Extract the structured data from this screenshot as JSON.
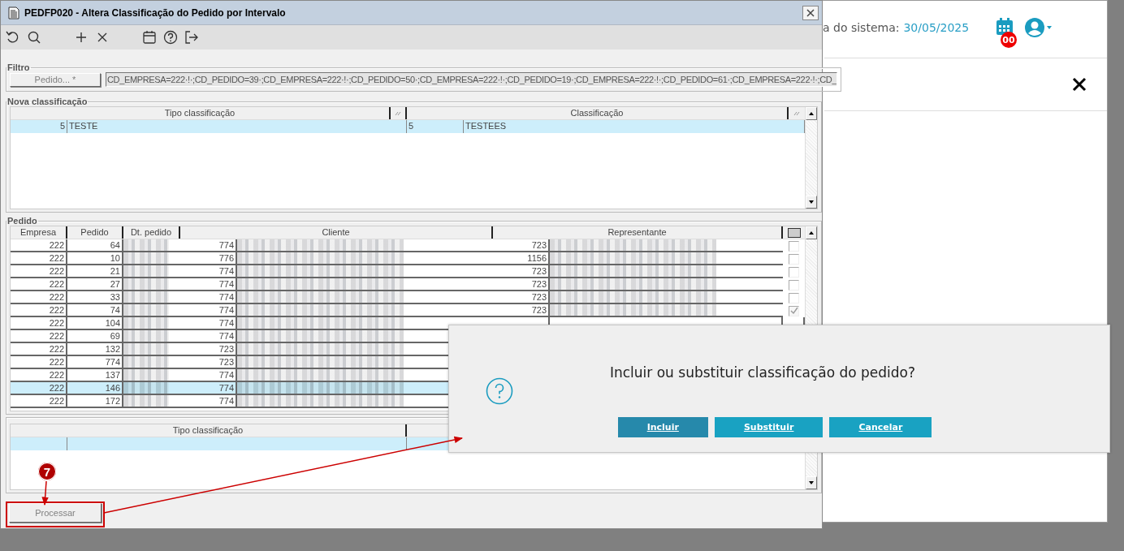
{
  "window": {
    "title": "PEDFP020 - Altera Classificação do Pedido por Intervalo"
  },
  "filter": {
    "legend": "Filtro",
    "button": {
      "label": "Pedido... *",
      "disabled": true
    },
    "value": "CD_EMPRESA=222·!·;CD_PEDIDO=39·;CD_EMPRESA=222·!·;CD_PEDIDO=50·;CD_EMPRESA=222·!·;CD_PEDIDO=19·;CD_EMPRESA=222·!·;CD_PEDIDO=61·;CD_EMPRESA=222·!·;CD_"
  },
  "nova": {
    "legend": "Nova classificação",
    "columns": [
      "Tipo classificação",
      "Classificação"
    ],
    "rows": [
      {
        "tipo_code": "5",
        "tipo": "TESTE",
        "class_code": "5",
        "class": "TESTEES",
        "selected": true
      }
    ]
  },
  "pedido": {
    "legend": "Pedido",
    "select_all": {
      "indeterminate": true
    },
    "columns": [
      "Empresa",
      "Pedido",
      "Dt. pedido",
      "Cliente",
      "Representante"
    ],
    "rows": [
      {
        "empresa": "222",
        "pedido": "64",
        "cliente": "774",
        "representante": "723",
        "checked": false,
        "selected": false
      },
      {
        "empresa": "222",
        "pedido": "10",
        "cliente": "776",
        "representante": "1156",
        "checked": false,
        "selected": false
      },
      {
        "empresa": "222",
        "pedido": "21",
        "cliente": "774",
        "representante": "723",
        "checked": false,
        "selected": false
      },
      {
        "empresa": "222",
        "pedido": "27",
        "cliente": "774",
        "representante": "723",
        "checked": false,
        "selected": false
      },
      {
        "empresa": "222",
        "pedido": "33",
        "cliente": "774",
        "representante": "723",
        "checked": false,
        "selected": false
      },
      {
        "empresa": "222",
        "pedido": "74",
        "cliente": "774",
        "representante": "723",
        "checked": true,
        "selected": false
      },
      {
        "empresa": "222",
        "pedido": "104",
        "cliente": "774",
        "selected": false
      },
      {
        "empresa": "222",
        "pedido": "69",
        "cliente": "774",
        "selected": false
      },
      {
        "empresa": "222",
        "pedido": "132",
        "cliente": "723",
        "selected": false
      },
      {
        "empresa": "222",
        "pedido": "774",
        "cliente": "723",
        "selected": false
      },
      {
        "empresa": "222",
        "pedido": "137",
        "cliente": "774",
        "selected": false
      },
      {
        "empresa": "222",
        "pedido": "146",
        "cliente": "774",
        "selected": true
      },
      {
        "empresa": "222",
        "pedido": "172",
        "cliente": "774",
        "selected": false
      }
    ]
  },
  "classification_grid": {
    "columns": [
      "Tipo classificação"
    ],
    "rows": [
      {
        "selected": true
      }
    ]
  },
  "process_button": {
    "label": "Processar",
    "disabled": true
  },
  "page": {
    "date_label": "a do sistema:",
    "date": "30/05/2025",
    "badge": "00"
  },
  "dialog": {
    "message": "Incluir ou substituir classificação do pedido?",
    "buttons": [
      {
        "label": "Incluir",
        "focused": true
      },
      {
        "label": "Substituir",
        "focused": false
      },
      {
        "label": "Cancelar",
        "focused": false
      }
    ]
  },
  "annotation": {
    "step": "7"
  }
}
